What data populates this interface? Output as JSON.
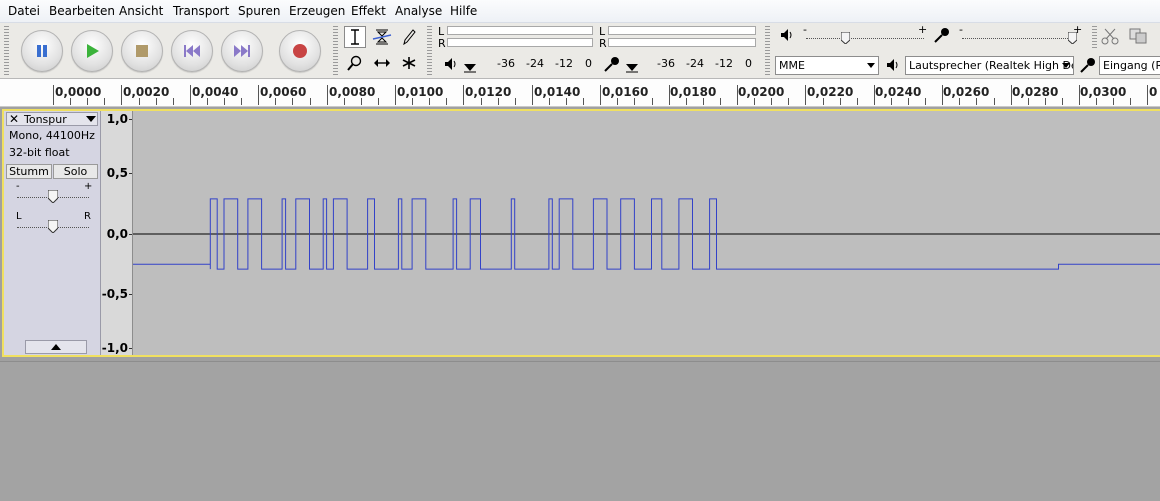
{
  "menu": [
    "Datei",
    "Bearbeiten",
    "Ansicht",
    "Transport",
    "Spuren",
    "Erzeugen",
    "Effekt",
    "Analyse",
    "Hilfe"
  ],
  "meter": {
    "left_label": "L",
    "right_label": "R",
    "playback_ticks": [
      "-36",
      "-24",
      "-12",
      "0"
    ],
    "record_ticks": [
      "-36",
      "-24",
      "-12",
      "0"
    ]
  },
  "mixer": {
    "minus": "-",
    "plus": "+",
    "playback_volume": 0.33,
    "record_volume": 0.98
  },
  "device": {
    "host": "MME",
    "output": "Lautsprecher (Realtek High De",
    "input": "Eingang (Re"
  },
  "ruler": {
    "labels": [
      "0,0000",
      "0,0020",
      "0,0040",
      "0,0060",
      "0,0080",
      "0,0100",
      "0,0120",
      "0,0140",
      "0,0160",
      "0,0180",
      "0,0200",
      "0,0220",
      "0,0240",
      "0,0260",
      "0,0280",
      "0,0300",
      "0"
    ]
  },
  "track": {
    "name": "Tonspur",
    "info_rate": "Mono, 44100Hz",
    "info_format": "32-bit float",
    "mute": "Stumm",
    "solo": "Solo",
    "gain_minus": "-",
    "gain_plus": "+",
    "pan_left": "L",
    "pan_right": "R",
    "gain": 0.5,
    "pan": 0.5,
    "vscale": [
      "1,0",
      "0,5",
      "0,0",
      "-0,5",
      "-1,0"
    ]
  },
  "waveform": {
    "high": 0.29,
    "low": -0.29,
    "idle": -0.25,
    "start_time": 0.0046,
    "end_time": 0.0294,
    "high_segments": [
      [
        0.0046,
        0.0048
      ],
      [
        0.005,
        0.0054
      ],
      [
        0.0057,
        0.0061
      ],
      [
        0.0067,
        0.0068
      ],
      [
        0.0071,
        0.0075
      ],
      [
        0.0079,
        0.008
      ],
      [
        0.0082,
        0.0086
      ],
      [
        0.0092,
        0.0094
      ],
      [
        0.0101,
        0.0102
      ],
      [
        0.0105,
        0.0109
      ],
      [
        0.0117,
        0.0118
      ],
      [
        0.0122,
        0.0125
      ],
      [
        0.0134,
        0.0135
      ],
      [
        0.0145,
        0.0146
      ],
      [
        0.0148,
        0.0152
      ],
      [
        0.0158,
        0.0162
      ],
      [
        0.0166,
        0.017
      ],
      [
        0.0175,
        0.0178
      ],
      [
        0.0183,
        0.0187
      ],
      [
        0.0192,
        0.0194
      ]
    ]
  }
}
